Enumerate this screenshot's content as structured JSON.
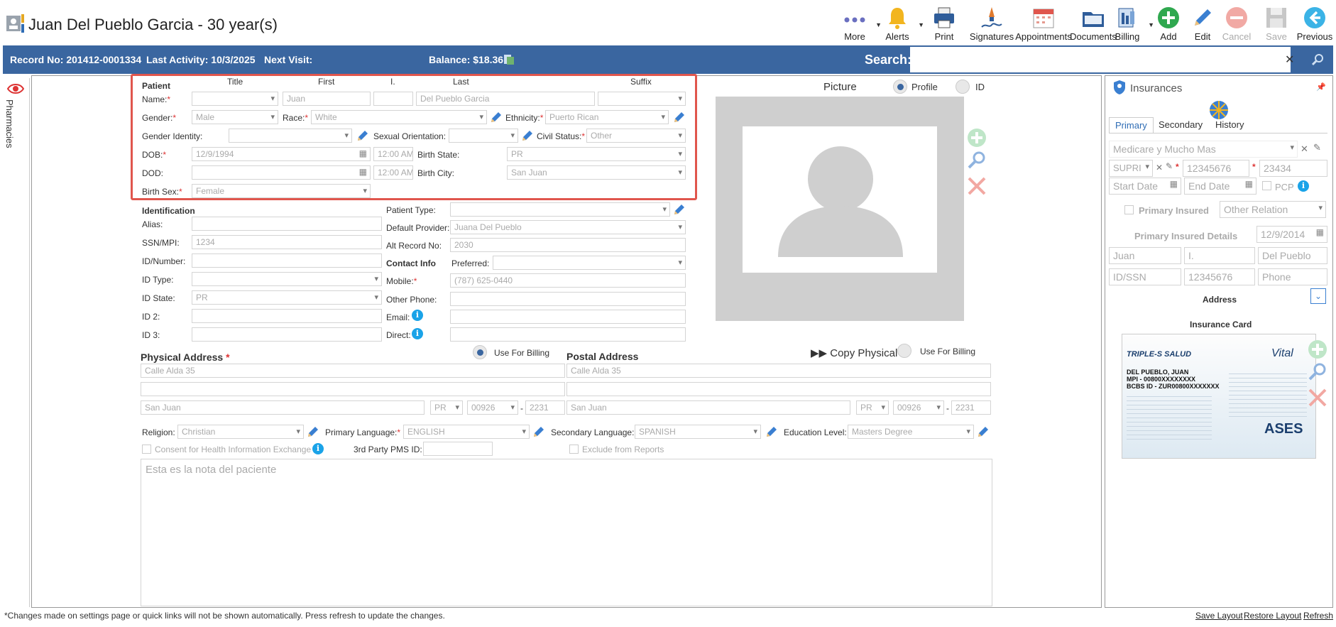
{
  "header": {
    "title": "Juan Del Pueblo Garcia - 30 year(s)",
    "toolbar": [
      {
        "label": "More",
        "icon": "more-icon"
      },
      {
        "label": "Alerts",
        "icon": "bell-icon"
      },
      {
        "label": "Print",
        "icon": "printer-icon"
      },
      {
        "label": "Signatures",
        "icon": "signature-icon"
      },
      {
        "label": "Appointments",
        "icon": "calendar-icon"
      },
      {
        "label": "Documents",
        "icon": "folder-icon"
      },
      {
        "label": "Billing",
        "icon": "billing-icon"
      },
      {
        "label": "Add",
        "icon": "plus-icon"
      },
      {
        "label": "Edit",
        "icon": "pencil-icon"
      },
      {
        "label": "Cancel",
        "icon": "cancel-icon"
      },
      {
        "label": "Save",
        "icon": "save-icon"
      },
      {
        "label": "Previous",
        "icon": "back-arrow-icon"
      }
    ]
  },
  "infobar": {
    "record": "Record No: 201412-0001334",
    "last_activity": "Last Activity: 10/3/2025",
    "next_visit": "Next Visit:",
    "balance": "Balance: $18.36",
    "search_label": "Search:"
  },
  "sidebar": {
    "label": "Pharmacies"
  },
  "patient": {
    "section": "Patient",
    "col_title": "Title",
    "col_first": "First",
    "col_initial": "I.",
    "col_last": "Last",
    "col_suffix": "Suffix",
    "name_label": "Name:",
    "first": "Juan",
    "last": "Del Pueblo Garcia",
    "gender_label": "Gender:",
    "gender": "Male",
    "race_label": "Race:",
    "race": "White",
    "ethnicity_label": "Ethnicity:",
    "ethnicity": "Puerto Rican",
    "gender_identity_label": "Gender Identity:",
    "sexual_orientation_label": "Sexual Orientation:",
    "civil_status_label": "Civil Status:",
    "civil_status": "Other",
    "dob_label": "DOB:",
    "dob": "12/9/1994",
    "dob_time": "12:00 AM",
    "dod_label": "DOD:",
    "dod_time": "12:00 AM",
    "birth_state_label": "Birth State:",
    "birth_state": "PR",
    "birth_city_label": "Birth City:",
    "birth_city": "San Juan",
    "birth_sex_label": "Birth Sex:",
    "birth_sex": "Female"
  },
  "identification": {
    "section": "Identification",
    "alias_label": "Alias:",
    "ssn_label": "SSN/MPI:",
    "ssn": "1234",
    "idnum_label": "ID/Number:",
    "idtype_label": "ID Type:",
    "idstate_label": "ID State:",
    "idstate": "PR",
    "id2_label": "ID 2:",
    "id3_label": "ID 3:",
    "patient_type_label": "Patient Type:",
    "default_provider_label": "Default Provider:",
    "default_provider": "Juana Del Pueblo",
    "alt_record_label": "Alt Record No:",
    "alt_record": "2030",
    "contact_section": "Contact Info",
    "preferred_label": "Preferred:",
    "mobile_label": "Mobile:",
    "mobile": "(787) 625-0440",
    "other_phone_label": "Other Phone:",
    "email_label": "Email:",
    "direct_label": "Direct:"
  },
  "picture": {
    "label": "Picture",
    "profile": "Profile",
    "id": "ID"
  },
  "physical": {
    "title": "Physical Address",
    "use_billing": "Use For Billing",
    "line1": "Calle Alda 35",
    "city": "San Juan",
    "state": "PR",
    "zip": "00926",
    "zip4": "2231"
  },
  "postal": {
    "title": "Postal Address",
    "copy": "Copy Physical",
    "use_billing": "Use For Billing",
    "line1": "Calle Alda 35",
    "city": "San Juan",
    "state": "PR",
    "zip": "00926",
    "zip4": "2231"
  },
  "misc": {
    "religion_label": "Religion:",
    "religion": "Christian",
    "primary_lang_label": "Primary Language:",
    "primary_lang": "ENGLISH",
    "secondary_lang_label": "Secondary Language:",
    "secondary_lang": "SPANISH",
    "education_label": "Education Level:",
    "education": "Masters Degree",
    "consent": "Consent for Health Information Exchange",
    "pms_label": "3rd Party PMS ID:",
    "exclude": "Exclude from Reports",
    "notes": "Esta es la nota del paciente"
  },
  "insurance": {
    "title": "Insurances",
    "tab_primary": "Primary",
    "tab_secondary": "Secondary",
    "tab_history": "History",
    "plan": "Medicare y Mucho Mas",
    "plan_code": "SUPRI",
    "member_id": "12345676",
    "group": "23434",
    "start_date": "Start Date",
    "end_date": "End Date",
    "pcp": "PCP",
    "primary_insured": "Primary Insured",
    "other_relation": "Other Relation",
    "details_label": "Primary Insured Details",
    "insured_dob": "12/9/2014",
    "insured_first": "Juan",
    "insured_initial": "I.",
    "insured_last": "Del Pueblo",
    "insured_idssn": "ID/SSN",
    "insured_id": "12345676",
    "insured_phone": "Phone",
    "address_label": "Address",
    "card_label": "Insurance Card"
  },
  "card": {
    "brand": "TRIPLE-S SALUD",
    "brand2": "Vital",
    "name": "DEL PUEBLO, JUAN",
    "mpi": "MPI - 00800XXXXXXXX",
    "bcbs": "BCBS ID - ZUR00800XXXXXXX",
    "ases": "ASES"
  },
  "footer": {
    "note": "*Changes made on settings page or quick links will not be shown automatically. Press refresh to update the changes.",
    "save_layout": "Save Layout",
    "restore_layout": "Restore Layout",
    "refresh": "Refresh"
  },
  "colors": {
    "accent": "#3a66a0",
    "highlight": "#e0564d",
    "info": "#1aa3e8"
  }
}
